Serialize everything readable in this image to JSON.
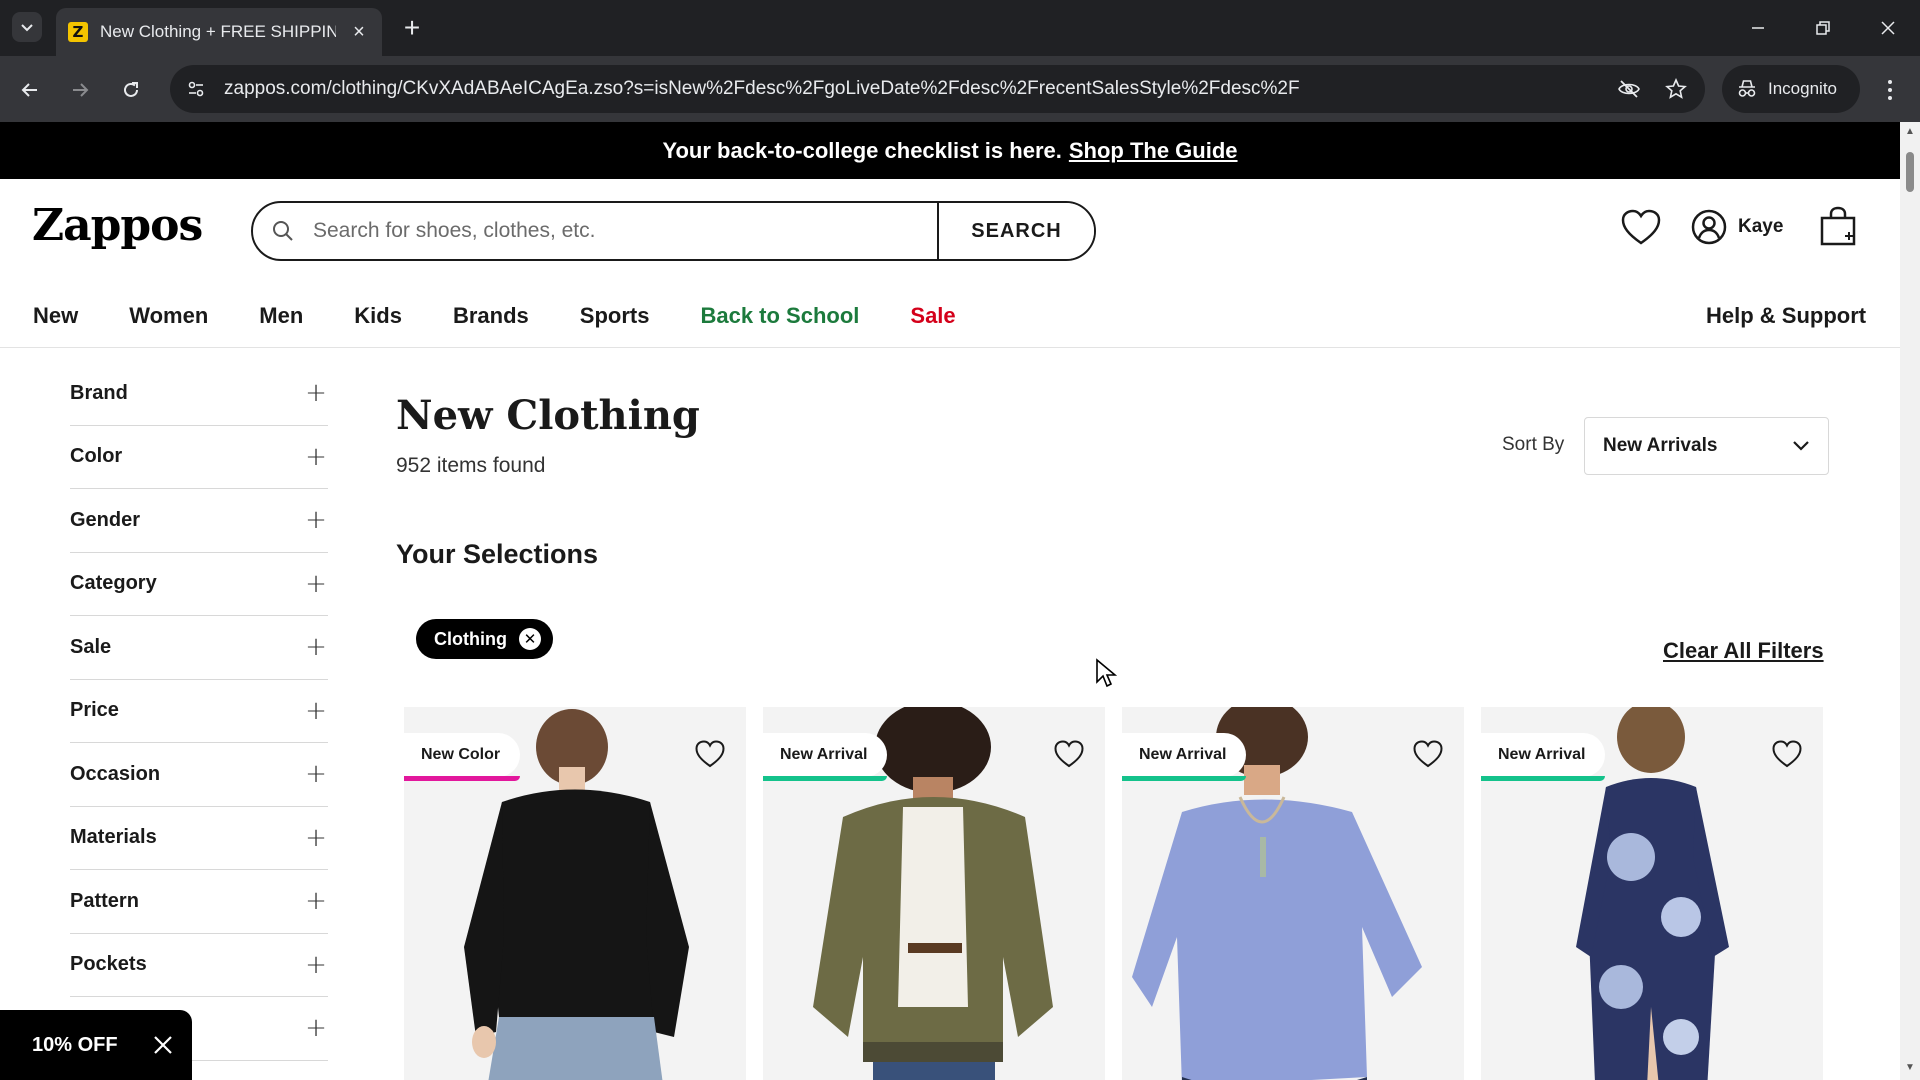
{
  "browser": {
    "tab_title": "New Clothing + FREE SHIPPING",
    "favicon_letter": "Z",
    "url": "zappos.com/clothing/CKvXAdABAeICAgEa.zso?s=isNew%2Fdesc%2FgoLiveDate%2Fdesc%2FrecentSalesStyle%2Fdesc%2F",
    "incognito_label": "Incognito"
  },
  "promo": {
    "text": "Your back-to-college checklist is here.",
    "link": "Shop The Guide"
  },
  "header": {
    "logo": "Zappos",
    "search_placeholder": "Search for shoes, clothes, etc.",
    "search_button": "SEARCH",
    "user_name": "Kaye"
  },
  "nav": {
    "items": [
      "New",
      "Women",
      "Men",
      "Kids",
      "Brands",
      "Sports",
      "Back to School",
      "Sale"
    ],
    "help": "Help & Support"
  },
  "filters": [
    "Brand",
    "Color",
    "Gender",
    "Category",
    "Sale",
    "Price",
    "Occasion",
    "Materials",
    "Pattern",
    "Pockets",
    ""
  ],
  "results": {
    "title": "New Clothing",
    "count": "952 items found",
    "sort_label": "Sort By",
    "sort_value": "New Arrivals",
    "selections_title": "Your Selections",
    "chip": "Clothing",
    "clear_all": "Clear All Filters"
  },
  "products": [
    {
      "badge": "New Color",
      "badge_color": "#e2179c",
      "icon": "black-top-jeans"
    },
    {
      "badge": "New Arrival",
      "badge_color": "#14c28b",
      "icon": "olive-bomber-jacket"
    },
    {
      "badge": "New Arrival",
      "badge_color": "#14c28b",
      "icon": "blue-knit-sweater"
    },
    {
      "badge": "New Arrival",
      "badge_color": "#14c28b",
      "icon": "floral-midi-dress"
    }
  ],
  "offer": {
    "label": "10% OFF"
  },
  "colors": {
    "brand_black": "#000000",
    "back_to_school": "#1c7a3c",
    "sale": "#d4001a"
  }
}
